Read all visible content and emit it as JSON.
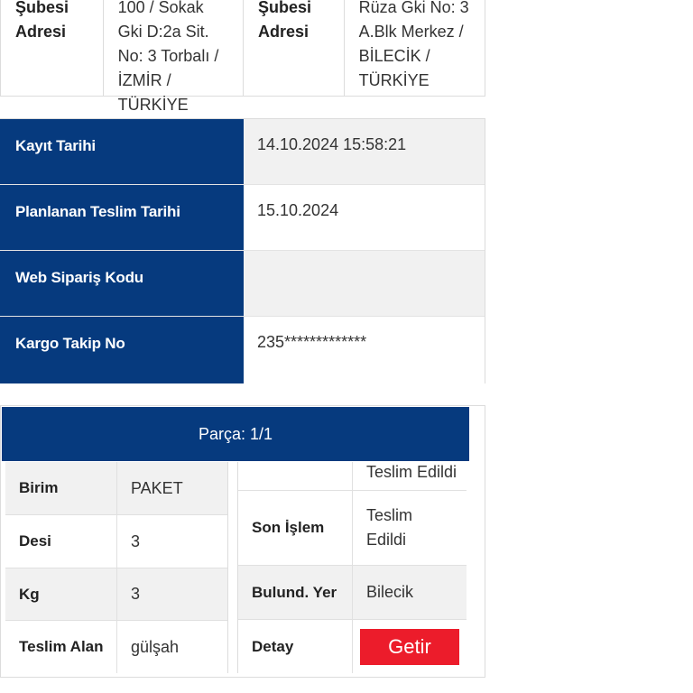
{
  "addresses": {
    "sender_label": "Şubesi Adresi",
    "sender_value": "100 / Sokak Gki D:2a Sit. No: 3 Torbalı / İZMİR / TÜRKİYE",
    "receiver_label": "Şubesi Adresi",
    "receiver_value": "Rüza Gki No: 3 A.Blk Merkez / BİLECİK / TÜRKİYE"
  },
  "info": {
    "rows": [
      {
        "label": "Kayıt Tarihi",
        "value": "14.10.2024 15:58:21"
      },
      {
        "label": "Planlanan Teslim Tarihi",
        "value": "15.10.2024"
      },
      {
        "label": "Web Sipariş Kodu",
        "value": ""
      },
      {
        "label": "Kargo Takip No",
        "value": "235*************"
      }
    ]
  },
  "parca": {
    "title": "Parça: 1/1",
    "left_rows": [
      {
        "label": "Birim",
        "value": "PAKET"
      },
      {
        "label": "Desi",
        "value": "3"
      },
      {
        "label": "Kg",
        "value": "3"
      },
      {
        "label": "Teslim Alan",
        "value": "gülşah"
      }
    ],
    "right_rows": [
      {
        "label": "",
        "value": "Teslim Edildi"
      },
      {
        "label": "Son İşlem",
        "value": "Teslim Edildi"
      },
      {
        "label": "Bulund. Yer",
        "value": "Bilecik"
      },
      {
        "label": "Detay",
        "button": "Getir"
      }
    ]
  },
  "colors": {
    "header_blue": "#063a7e",
    "button_red": "#ec1c2b",
    "row_gray": "#f1f1f1"
  }
}
